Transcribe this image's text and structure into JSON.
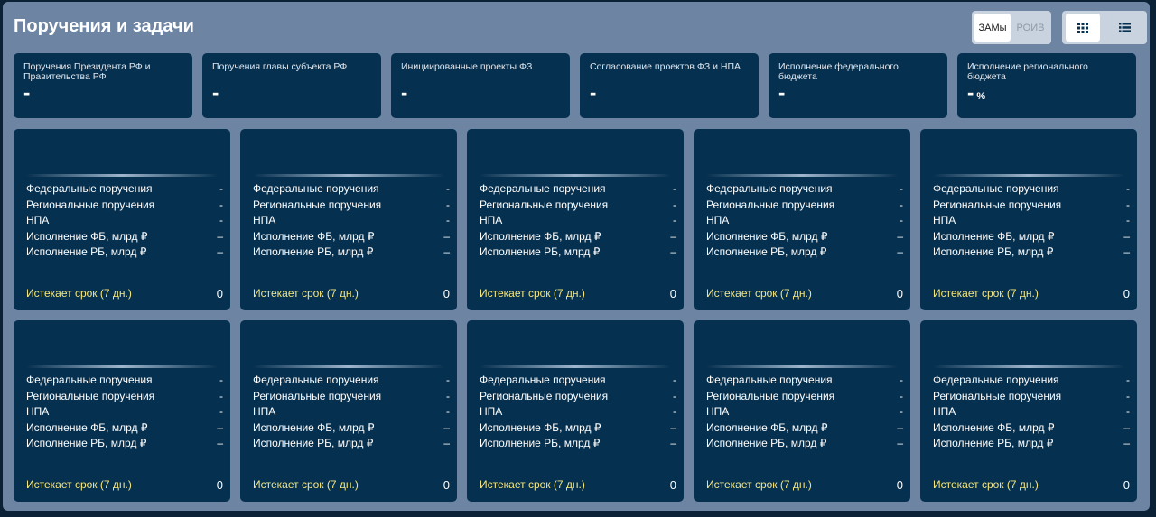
{
  "header": {
    "title": "Поручения и задачи"
  },
  "mode_toggle": {
    "zamy_label": "ЗАМы",
    "roiv_label": "РОИВ"
  },
  "view_toggle": {
    "grid_icon": "grid-icon",
    "list_icon": "list-icon"
  },
  "kpis": [
    {
      "label": "Поручения Президента РФ и Правительства РФ",
      "value": "-",
      "unit": ""
    },
    {
      "label": "Поручения главы субъекта РФ",
      "value": "-",
      "unit": ""
    },
    {
      "label": "Инициированные проекты ФЗ",
      "value": "-",
      "unit": ""
    },
    {
      "label": "Согласование проектов ФЗ и НПА",
      "value": "-",
      "unit": ""
    },
    {
      "label": "Исполнение федерального бюджета",
      "value": "-",
      "unit": ""
    },
    {
      "label": "Исполнение регионального бюджета",
      "value": "-",
      "unit": "%"
    }
  ],
  "card_template": {
    "rows": [
      {
        "label": "Федеральные поручения",
        "value": "-"
      },
      {
        "label": "Региональные поручения",
        "value": "-"
      },
      {
        "label": "НПА",
        "value": "-"
      },
      {
        "label": "Исполнение ФБ, млрд ₽",
        "value": "–"
      },
      {
        "label": "Исполнение РБ, млрд ₽",
        "value": "–"
      }
    ],
    "footer_label": "Истекает срок (7 дн.)",
    "footer_value": "0"
  },
  "card_count": 10,
  "colors": {
    "panel": "#6d85a3",
    "card": "#06304f",
    "accent_yellow": "#f3e680"
  }
}
